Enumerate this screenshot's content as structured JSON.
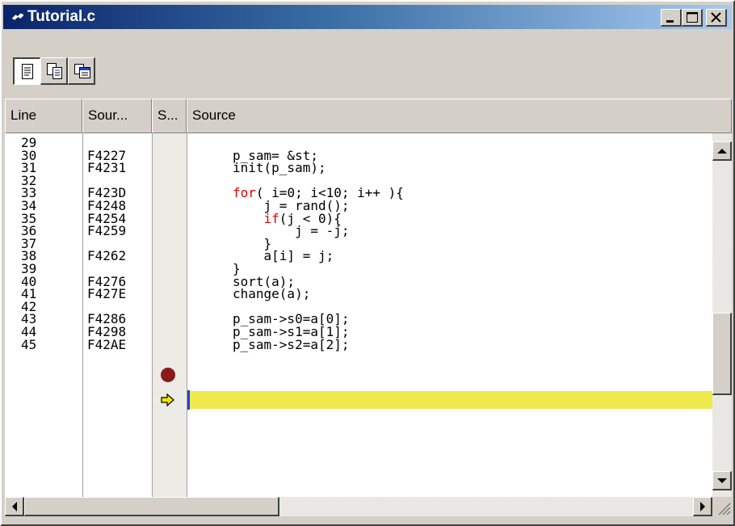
{
  "window": {
    "title": "Tutorial.c",
    "buttons": {
      "minimize": "minimize",
      "maximize": "maximize",
      "close": "close"
    }
  },
  "toolbar": {
    "buttons": [
      {
        "icon": "source-view-icon",
        "pressed": true
      },
      {
        "icon": "mixed-view-icon",
        "pressed": false
      },
      {
        "icon": "disassembly-view-icon",
        "pressed": false
      }
    ]
  },
  "columns": {
    "line": "Line",
    "address": "Sour...",
    "status": "S...",
    "source": "Source"
  },
  "rows": [
    {
      "line": "29",
      "addr": "",
      "src": ""
    },
    {
      "line": "30",
      "addr": "F4227",
      "src": "p_sam= &st;"
    },
    {
      "line": "31",
      "addr": "F4231",
      "src": "init(p_sam);"
    },
    {
      "line": "32",
      "addr": "",
      "src": ""
    },
    {
      "line": "33",
      "addr": "F423D",
      "src": "",
      "kw": "for",
      "rest": "( i=0; i<10; i++ ){"
    },
    {
      "line": "34",
      "addr": "F4248",
      "src": "    j = rand();"
    },
    {
      "line": "35",
      "addr": "F4254",
      "src": "",
      "indent": "    ",
      "kw": "if",
      "rest": "(j < 0){"
    },
    {
      "line": "36",
      "addr": "F4259",
      "src": "        j = -j;"
    },
    {
      "line": "37",
      "addr": "",
      "src": "    }"
    },
    {
      "line": "38",
      "addr": "F4262",
      "src": "    a[i] = j;"
    },
    {
      "line": "39",
      "addr": "",
      "src": "}"
    },
    {
      "line": "40",
      "addr": "F4276",
      "src": "sort(a);",
      "status": "breakpoint"
    },
    {
      "line": "41",
      "addr": "F427E",
      "src": "change(a);",
      "status": "pc"
    },
    {
      "line": "42",
      "addr": "",
      "src": ""
    },
    {
      "line": "43",
      "addr": "F4286",
      "src": "p_sam->s0=a[0];"
    },
    {
      "line": "44",
      "addr": "F4298",
      "src": "p_sam->s1=a[1];"
    },
    {
      "line": "45",
      "addr": "F42AE",
      "src": "p_sam->s2=a[2];"
    }
  ],
  "colors": {
    "highlight": "#efe84b",
    "keyword": "#e60000",
    "breakpoint": "#8b1a1a",
    "pc_arrow": "#f5e600",
    "title_start": "#0a246a",
    "title_end": "#a6caf0"
  },
  "scroll": {
    "vertical_position": 0.55,
    "horizontal_position": 0.0
  }
}
